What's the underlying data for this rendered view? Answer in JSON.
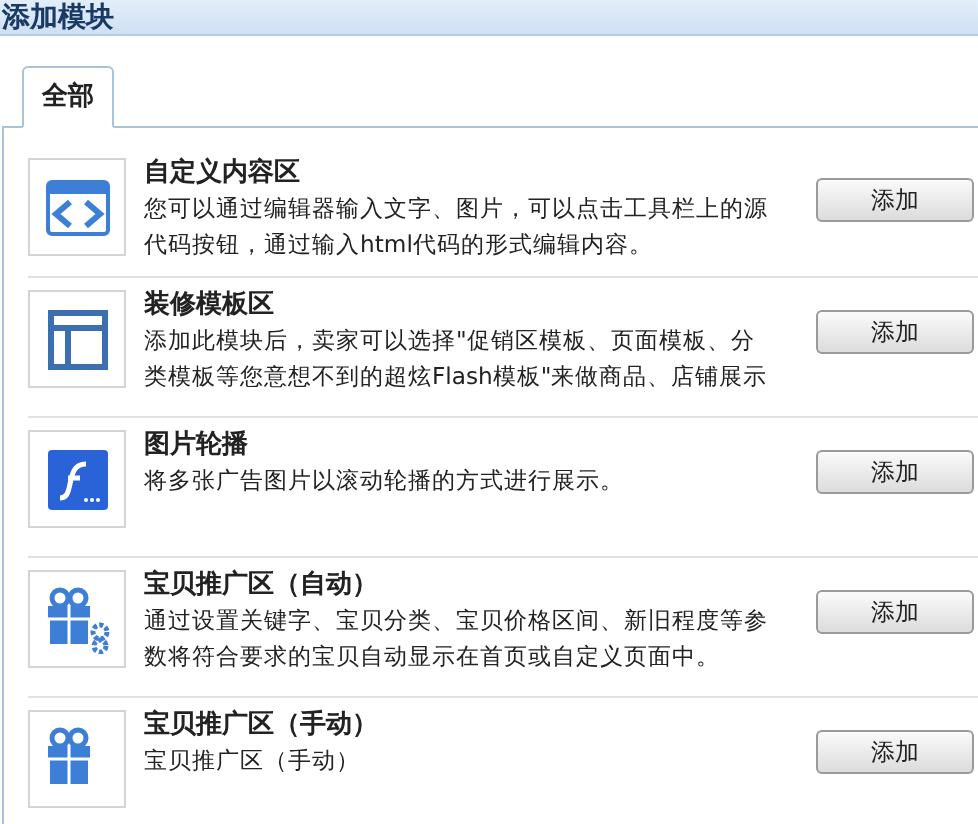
{
  "header": {
    "title": "添加模块"
  },
  "tabs": [
    {
      "label": "全部",
      "selected": true
    }
  ],
  "modules": [
    {
      "kind": "code",
      "title": "自定义内容区",
      "description": "您可以通过编辑器输入文字、图片，可以点击工具栏上的源代码按钮，通过输入html代码的形式编辑内容。",
      "button": "添加"
    },
    {
      "kind": "layout",
      "title": "装修模板区",
      "description": "添加此模块后，卖家可以选择\"促销区模板、页面模板、分类模板等您意想不到的超炫Flash模板\"来做商品、店铺展示",
      "button": "添加"
    },
    {
      "kind": "flash",
      "title": "图片轮播",
      "description": "将多张广告图片以滚动轮播的方式进行展示。",
      "button": "添加"
    },
    {
      "kind": "gift-gear",
      "title": "宝贝推广区（自动）",
      "description": "通过设置关键字、宝贝分类、宝贝价格区间、新旧程度等参数将符合要求的宝贝自动显示在首页或自定义页面中。",
      "button": "添加"
    },
    {
      "kind": "gift",
      "title": "宝贝推广区（手动）",
      "description": "宝贝推广区（手动）",
      "button": "添加"
    }
  ]
}
